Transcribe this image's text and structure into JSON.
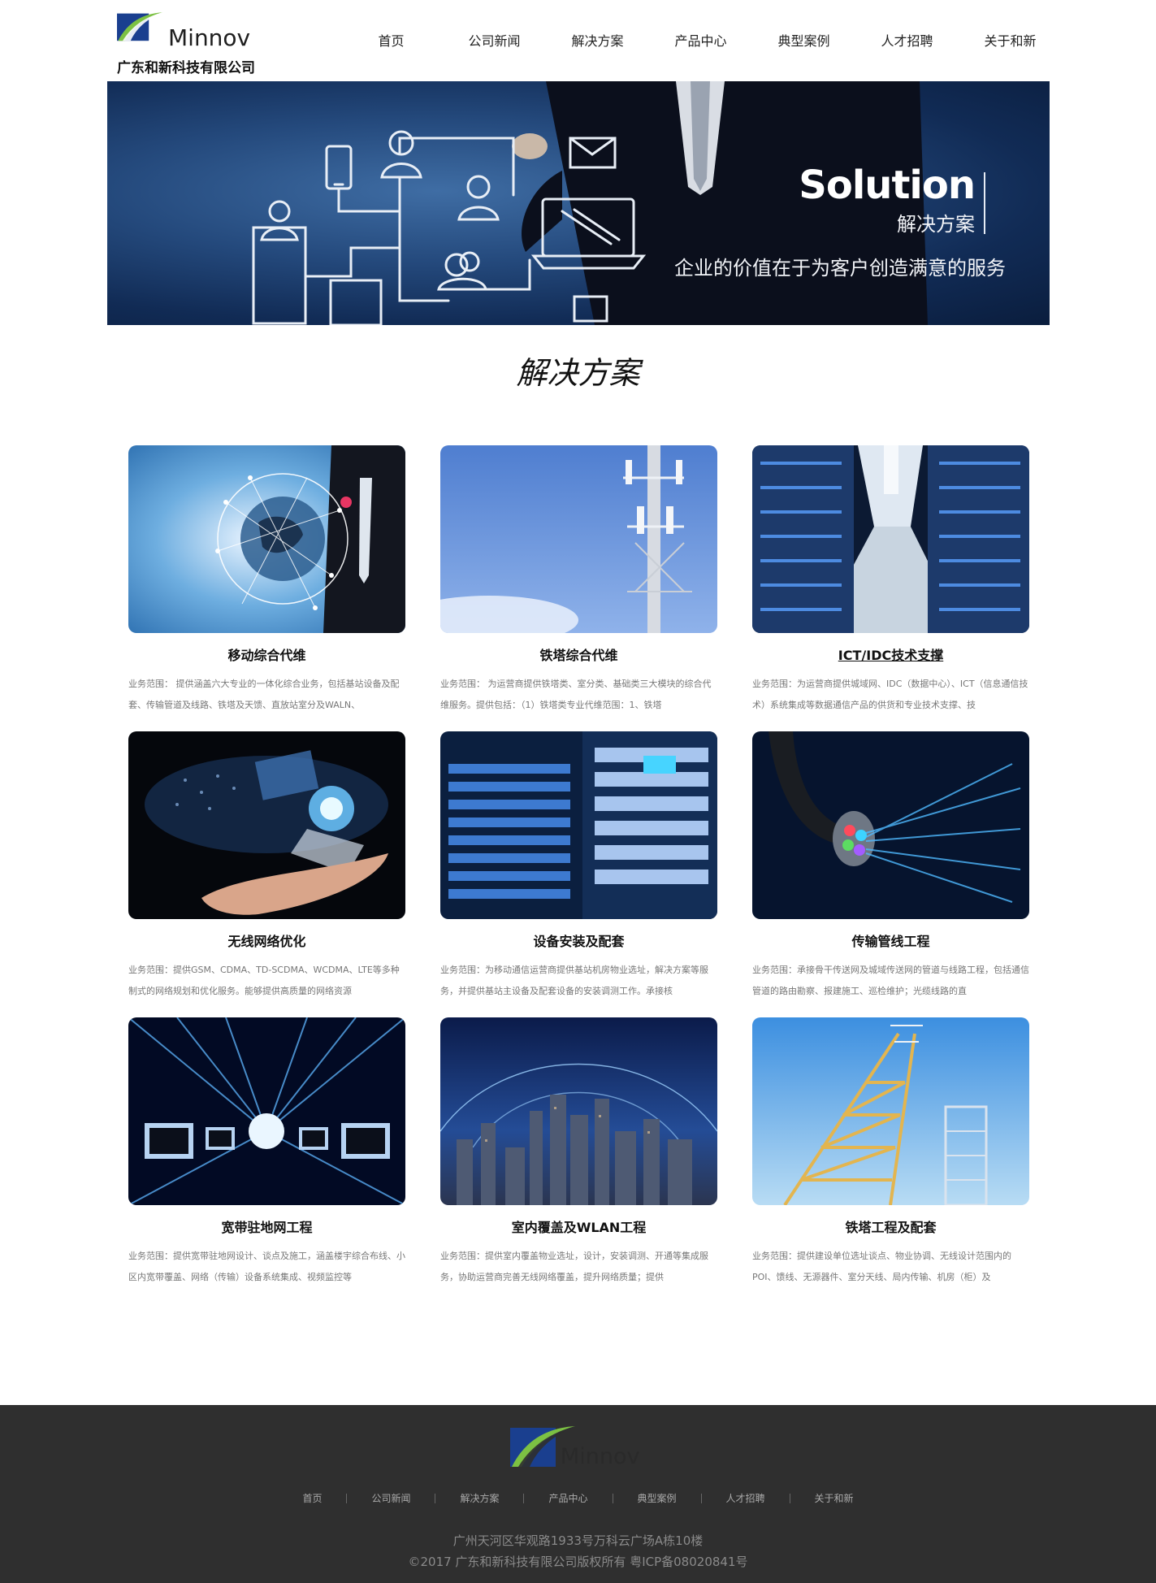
{
  "header": {
    "logo_word": "Minnov",
    "company": "广东和新科技有限公司",
    "nav": [
      "首页",
      "公司新闻",
      "解决方案",
      "产品中心",
      "典型案例",
      "人才招聘",
      "关于和新"
    ]
  },
  "banner": {
    "title": "Solution",
    "subtitle": "解决方案",
    "slogan": "企业的价值在于为客户创造满意的服务"
  },
  "section_title": "解决方案",
  "cards": [
    {
      "title": "移动综合代维",
      "desc": "业务范围：  提供涵盖六大专业的一体化综合业务，包括基站设备及配套、传输管道及线路、铁塔及天馈、直放站室分及WALN、"
    },
    {
      "title": "铁塔综合代维",
      "desc": "业务范围：  为运营商提供铁塔类、室分类、基础类三大模块的综合代维服务。提供包括：（1）铁塔类专业代维范围：1、铁塔"
    },
    {
      "title": "ICT/IDC技术支撑",
      "desc": "业务范围：为运营商提供城域网、IDC（数据中心）、ICT（信息通信技术）系统集成等数据通信产品的供货和专业技术支撑、技"
    },
    {
      "title": "无线网络优化",
      "desc": "业务范围：提供GSM、CDMA、TD-SCDMA、WCDMA、LTE等多种制式的网络规划和优化服务。能够提供高质量的网络资源"
    },
    {
      "title": "设备安装及配套",
      "desc": "业务范围：为移动通信运营商提供基站机房物业选址，解决方案等服务，并提供基站主设备及配套设备的安装调测工作。承接核"
    },
    {
      "title": "传输管线工程",
      "desc": "业务范围：承接骨干传送网及城域传送网的管道与线路工程，包括通信管道的路由勘察、报建施工、巡检维护；光缆线路的直"
    },
    {
      "title": "宽带驻地网工程",
      "desc": "业务范围：提供宽带驻地网设计、谈点及施工，涵盖楼宇综合布线、小区内宽带覆盖、网络（传输）设备系统集成、视频监控等"
    },
    {
      "title": "室内覆盖及WLAN工程",
      "desc": "业务范围：提供室内覆盖物业选址，设计，安装调测、开通等集成服务，协助运营商完善无线网络覆盖，提升网络质量；提供"
    },
    {
      "title": "铁塔工程及配套",
      "desc": "业务范围：提供建设单位选址谈点、物业协调、无线设计范围内的POI、馈线、无源器件、室分天线、局内传输、机房（柜）及"
    }
  ],
  "footer": {
    "logo_word": "Minnov",
    "nav": [
      "首页",
      "公司新闻",
      "解决方案",
      "产品中心",
      "典型案例",
      "人才招聘",
      "关于和新"
    ],
    "address": "广州天河区华观路1933号万科云广场A栋10楼",
    "copyright": "©2017 广东和新科技有限公司版权所有   粤ICP备08020841号"
  },
  "colors": {
    "logo_blue": "#1a3f8f",
    "logo_green": "#7cc143",
    "banner_navy": "#112b55",
    "footer_bg": "#2f2f2f"
  }
}
